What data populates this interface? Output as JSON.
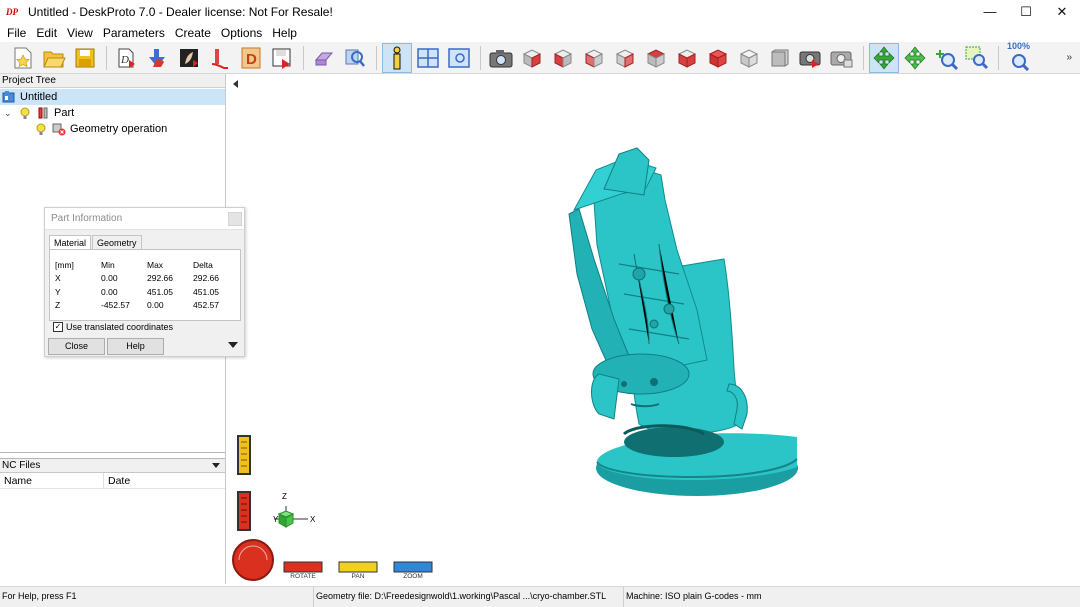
{
  "app": {
    "logo": "DP",
    "title": "Untitled - DeskProto 7.0 - Dealer license: Not For Resale!",
    "window_controls": {
      "minimize": "—",
      "maximize": "☐",
      "close": "✕"
    }
  },
  "menu": [
    "File",
    "Edit",
    "View",
    "Parameters",
    "Create",
    "Options",
    "Help"
  ],
  "toolbar": {
    "zoom_label": "100%",
    "more": "»",
    "icons": [
      "new-file-icon",
      "open-folder-icon",
      "save-icon",
      "import-geometry-icon",
      "part-wizard-icon",
      "vector-wizard-icon",
      "bitmap-wizard-icon",
      "decoration-icon",
      "export-icon",
      "erase-icon",
      "inspect-icon",
      "info-icon",
      "window-layout-icon",
      "preview-icon",
      "camera-icon",
      "view-front-icon",
      "view-back-icon",
      "view-left-icon",
      "view-right-icon",
      "view-top-icon",
      "view-bottom-icon",
      "view-iso-icon",
      "view-iso2-icon",
      "screenshot-icon",
      "print-screen-icon",
      "rotate-view-icon",
      "pan-view-icon",
      "zoom-in-icon",
      "zoom-window-icon",
      "zoom-100-icon"
    ]
  },
  "project_tree": {
    "header": "Project Tree",
    "items": [
      {
        "label": "Untitled",
        "level": 0,
        "icon": "project-icon",
        "selected": true
      },
      {
        "label": "Part",
        "level": 1,
        "icon": "part-icon",
        "selected": false
      },
      {
        "label": "Geometry operation",
        "level": 2,
        "icon": "geometry-operation-icon",
        "selected": false
      }
    ]
  },
  "nc_files": {
    "header": "NC Files",
    "columns": [
      "Name",
      "Date"
    ]
  },
  "part_info": {
    "title": "Part Information",
    "tabs": [
      "Material",
      "Geometry"
    ],
    "active_tab": "Material",
    "table": {
      "headers": [
        "[mm]",
        "Min",
        "Max",
        "Delta"
      ],
      "rows": [
        [
          "X",
          "0.00",
          "292.66",
          "292.66"
        ],
        [
          "Y",
          "0.00",
          "451.05",
          "451.05"
        ],
        [
          "Z",
          "-452.57",
          "0.00",
          "452.57"
        ]
      ]
    },
    "checkbox_label": "Use translated coordinates",
    "checkbox_checked": true,
    "close_label": "Close",
    "help_label": "Help"
  },
  "viewport": {
    "axis": {
      "x": "X",
      "y": "Y",
      "z": "Z"
    },
    "modes": [
      "ROTATE",
      "PAN",
      "ZOOM"
    ],
    "model_color": "#2bc5c8"
  },
  "status": {
    "help": "For Help, press F1",
    "geometry_file": "Geometry file: D:\\Freedesignwold\\1.working\\Pascal ...\\cryo-chamber.STL",
    "machine": "Machine: ISO plain G-codes - mm"
  }
}
